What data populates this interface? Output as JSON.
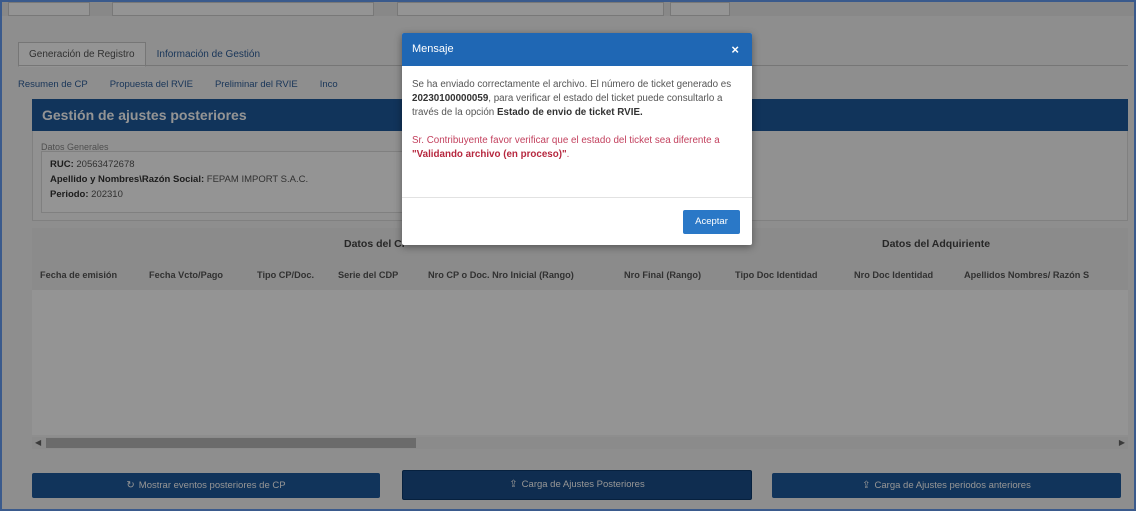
{
  "tabs": [
    {
      "label": "Generación de Registro",
      "active": true
    },
    {
      "label": "Información de Gestión",
      "active": false
    }
  ],
  "subtabs": [
    "Resumen de CP",
    "Propuesta del RVIE",
    "Preliminar del RVIE",
    "Inco"
  ],
  "panel": {
    "title": "Gestión de ajustes posteriores",
    "section_legend": "Datos Generales",
    "ruc_label": "RUC:",
    "ruc_value": "20563472678",
    "name_label": "Apellido y Nombres\\Razón Social:",
    "name_value": "FEPAM IMPORT S.A.C.",
    "period_label": "Periodo:",
    "period_value": "202310"
  },
  "table": {
    "group_headers": [
      "Datos del CP",
      "Datos del Adquiriente"
    ],
    "columns": [
      "Fecha de emisión",
      "Fecha Vcto/Pago",
      "Tipo CP/Doc.",
      "Serie del CDP",
      "Nro CP o Doc. Nro Inicial (Rango)",
      "Nro Final (Rango)",
      "Tipo Doc Identidad",
      "Nro Doc Identidad",
      "Apellidos Nombres/ Razón S"
    ]
  },
  "buttons": {
    "show_events": "Mostrar eventos posteriores de CP",
    "upload_adjust": "Carga de Ajustes Posteriores",
    "upload_prev": "Carga de Ajustes periodos anteriores"
  },
  "modal": {
    "title": "Mensaje",
    "close": "×",
    "msg_part1": "Se ha enviado correctamente el archivo. El número de ticket generado es ",
    "ticket": "20230100000059",
    "msg_part2": ", para verificar el estado del ticket puede consultarlo a través de la opción ",
    "option": "Estado de envio de ticket RVIE.",
    "warn_part1": "Sr. Contribuyente favor verificar que el estado del ticket sea diferente a ",
    "warn_status": "\"Validando archivo (en proceso)\"",
    "warn_part2": ".",
    "accept": "Aceptar"
  },
  "icons": {
    "refresh": "refresh-icon",
    "upload": "upload-icon",
    "close": "close-icon"
  },
  "colors": {
    "primary": "#1e5b9e",
    "modal_header": "#1f67b4",
    "warning": "#c3415e"
  }
}
